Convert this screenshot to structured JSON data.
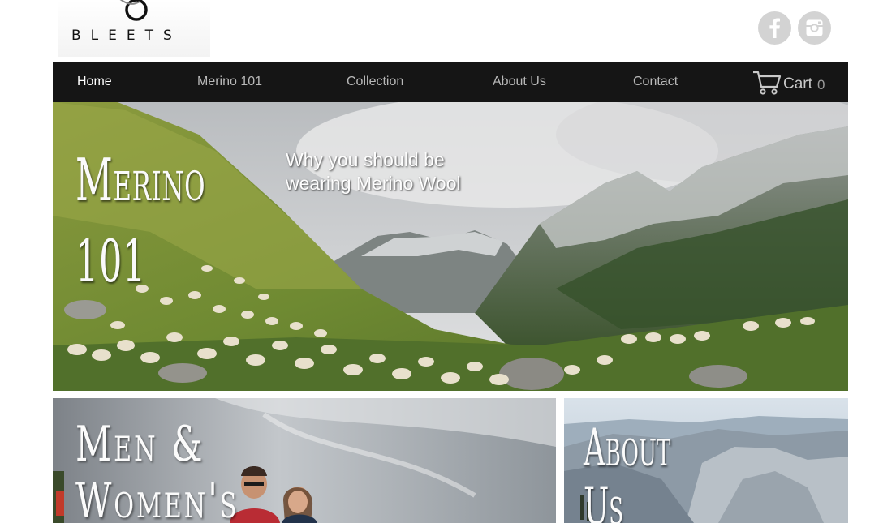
{
  "header": {
    "logo_text": "BLEETS",
    "social": [
      {
        "icon": "facebook-icon",
        "color": "#d3d3d3"
      },
      {
        "icon": "instagram-icon",
        "color": "#d3d3d3"
      }
    ]
  },
  "nav": {
    "items": [
      {
        "label": "Home",
        "active": true
      },
      {
        "label": "Merino 101"
      },
      {
        "label": "Collection"
      },
      {
        "label": "About Us"
      },
      {
        "label": "Contact"
      }
    ],
    "cart_label": "Cart",
    "cart_count": "0",
    "background": "#151515"
  },
  "hero": {
    "title_line1": "Merino",
    "title_line2": "101",
    "subtitle_line1": "Why you should be",
    "subtitle_line2": "wearing Merino Wool"
  },
  "cards": {
    "men_line1": "Men &",
    "men_line2": "Women's",
    "about_line1": "About",
    "about_line2": "Us"
  }
}
